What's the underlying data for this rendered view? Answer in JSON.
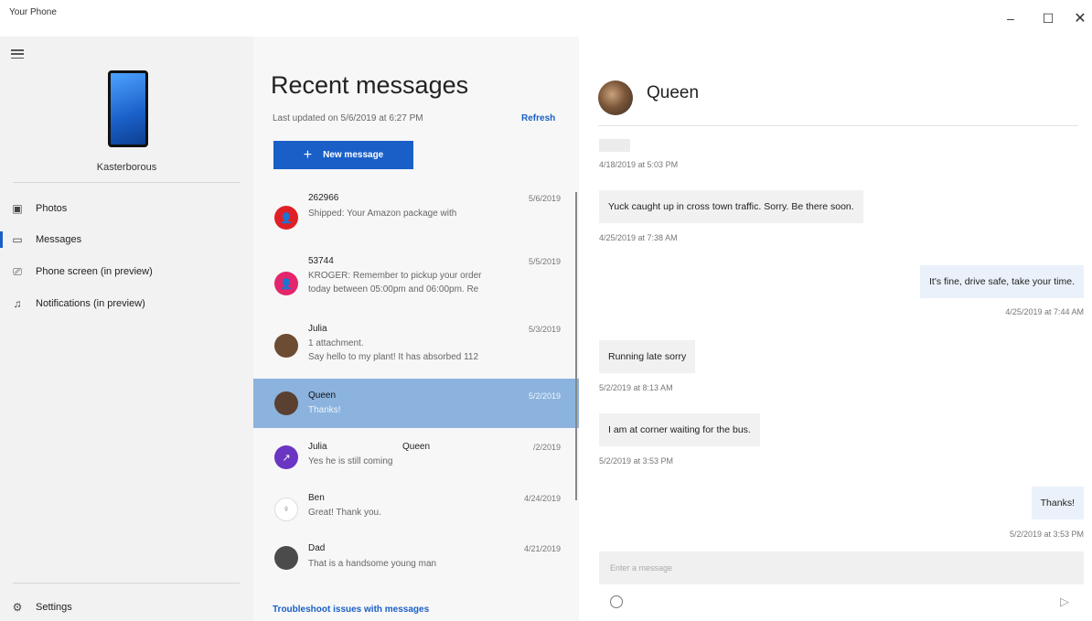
{
  "window": {
    "title": "Your Phone",
    "min_glyph": "–",
    "max_glyph": "☐",
    "close_glyph": "✕"
  },
  "sidebar": {
    "device_name": "Kasterborous",
    "items": [
      {
        "label": "Photos",
        "icon": "photos-icon",
        "glyph": "▣"
      },
      {
        "label": "Messages",
        "icon": "messages-icon",
        "glyph": "▭"
      },
      {
        "label": "Phone screen (in preview)",
        "icon": "phone-screen-icon",
        "glyph": "⎚"
      },
      {
        "label": "Notifications (in preview)",
        "icon": "bell-icon",
        "glyph": "♫"
      }
    ],
    "settings": {
      "label": "Settings",
      "icon": "gear-icon",
      "glyph": "⚙"
    }
  },
  "messages": {
    "title": "Recent messages",
    "updated": "Last updated on 5/6/2019 at 6:27 PM",
    "refresh": "Refresh",
    "new_message": "New message",
    "new_glyph": "+",
    "troubleshoot": "Troubleshoot issues with messages",
    "conversations": [
      {
        "name": "262966",
        "date": "5/6/2019",
        "preview": [
          "Shipped: Your Amazon package with"
        ],
        "color": "#e02027",
        "glyph": "👤"
      },
      {
        "name": "53744",
        "date": "5/5/2019",
        "preview": [
          "KROGER: Remember to pickup your order",
          "today between 05:00pm and 06:00pm. Re"
        ],
        "color": "#e3266b",
        "glyph": "👤"
      },
      {
        "name": "Julia",
        "date": "5/3/2019",
        "preview": [
          "1 attachment.",
          "Say hello to my plant! It has absorbed 112"
        ],
        "color": "#6d4c34",
        "glyph": ""
      },
      {
        "name": "Queen",
        "date": "5/2/2019",
        "preview": [
          "Thanks!"
        ],
        "color": "#5a4030",
        "glyph": ""
      },
      {
        "name": "Julia",
        "extra": "Queen",
        "date": "/2/2019",
        "preview": [
          "Yes he is still coming"
        ],
        "color": "#6a35c2",
        "glyph": "↗"
      },
      {
        "name": "Ben",
        "date": "4/24/2019",
        "preview": [
          "Great! Thank you."
        ],
        "color": "#ffffff",
        "glyph": "♀"
      },
      {
        "name": "Dad",
        "date": "4/21/2019",
        "preview": [
          "That is a handsome young man"
        ],
        "color": "#4b4b4b",
        "glyph": ""
      }
    ]
  },
  "chat": {
    "contact": "Queen",
    "input_placeholder": "Enter a message",
    "send_glyph": "▷",
    "items": [
      {
        "kind": "ts",
        "text": "4/18/2019 at 5:03 PM"
      },
      {
        "kind": "in",
        "text": "Yuck caught up in cross town traffic. Sorry. Be there soon."
      },
      {
        "kind": "ts",
        "text": "4/25/2019 at 7:38 AM"
      },
      {
        "kind": "out",
        "text": "It's fine, drive safe, take your time."
      },
      {
        "kind": "ts",
        "text": "4/25/2019 at 7:44 AM"
      },
      {
        "kind": "in",
        "text": "Running late sorry"
      },
      {
        "kind": "ts",
        "text": "5/2/2019 at 8:13 AM"
      },
      {
        "kind": "in",
        "text": "I am at corner waiting for the bus."
      },
      {
        "kind": "ts",
        "text": "5/2/2019 at 3:53 PM"
      },
      {
        "kind": "out",
        "text": "Thanks!"
      },
      {
        "kind": "ts",
        "text": "5/2/2019 at 3:53 PM"
      }
    ]
  }
}
